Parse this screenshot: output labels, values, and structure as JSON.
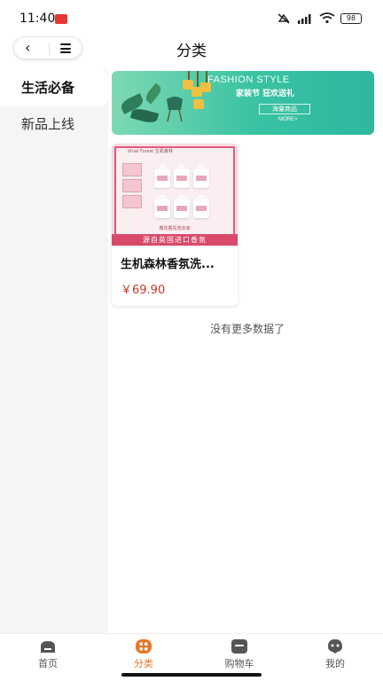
{
  "status_bar": {
    "time": "11:40",
    "battery": "98",
    "icons": [
      "app-notification-icon",
      "no-notification-icon",
      "hd-signal-icon",
      "wifi-icon",
      "battery-icon"
    ]
  },
  "header": {
    "title": "分类",
    "back_icon": "chevron-left-icon",
    "menu_icon": "menu-icon"
  },
  "sidebar": {
    "items": [
      {
        "label": "生活必备",
        "active": true
      },
      {
        "label": "新品上线",
        "active": false
      }
    ]
  },
  "banner": {
    "title": "FASHION STYLE",
    "subtitle": "家装节 狂欢送礼",
    "box_text": "海量商品",
    "more": "MORE>"
  },
  "products": [
    {
      "image_brand": "Vinal Forest 生机森林",
      "image_caption_small": "樱花香氛洗衣液",
      "image_caption": "源自英国进口香氛",
      "name": "生机森林香氛洗...",
      "price": "￥69.90"
    }
  ],
  "footer_note": "没有更多数据了",
  "tabbar": {
    "tabs": [
      {
        "label": "首页",
        "icon": "home-icon",
        "active": false
      },
      {
        "label": "分类",
        "icon": "category-icon",
        "active": true
      },
      {
        "label": "购物车",
        "icon": "cart-icon",
        "active": false
      },
      {
        "label": "我的",
        "icon": "profile-icon",
        "active": false
      }
    ]
  },
  "colors": {
    "accent": "#e8762b",
    "price": "#c0392b",
    "sidebar_bg": "#f5f5f5",
    "banner_green": "#39c2a3"
  }
}
